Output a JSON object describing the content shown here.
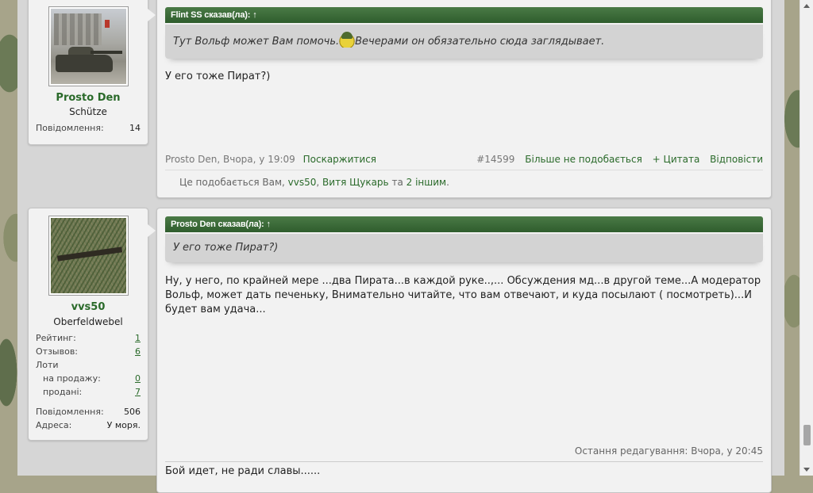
{
  "posts": [
    {
      "author": {
        "name": "Prosto Den",
        "rank": "Schütze",
        "messages_label": "Повідомлення:",
        "messages": "14",
        "avatar": "tank-avatar"
      },
      "quote": {
        "author_line": "Flint SS сказав(ла):",
        "arrow": "↑",
        "text_before": "Тут Вольф может Вам помочь.",
        "text_after": "Вечерами он обязательно сюда заглядывает.",
        "smiley": "soldier-smiley"
      },
      "text": "У его тоже Пират?)",
      "meta": {
        "author_date": "Prosto Den, Вчора, у 19:09",
        "report": "Поскаржитися",
        "post_number": "#14599",
        "unlike": "Більше не подобається",
        "quote": "+ Цитата",
        "reply": "Відповісти"
      },
      "likes": {
        "prefix": "Це подобається Вам,",
        "user1": "vvs50",
        "user2": "Витя Щукарь",
        "middle": "та",
        "others": "2 іншим",
        "suffix": "."
      }
    },
    {
      "author": {
        "name": "vvs50",
        "rank": "Oberfeldwebel",
        "rating_label": "Рейтинг:",
        "rating": "1",
        "reviews_label": "Отзывов:",
        "reviews": "6",
        "lots_label": "Лоти",
        "on_sale_label": "на продажу:",
        "on_sale": "0",
        "sold_label": "продані:",
        "sold": "7",
        "messages_label": "Повідомлення:",
        "messages": "506",
        "address_label": "Адреса:",
        "address": "У моря.",
        "avatar": "camo-rifle-avatar"
      },
      "quote": {
        "author_line": "Prosto Den сказав(ла):",
        "arrow": "↑",
        "text": "У его тоже Пират?)"
      },
      "text": "Ну, у него, по крайней мере ...два Пирата...в каждой руке..,... Обсуждения мд...в другой теме...А модератор Вольф, может дать печеньку, Внимательно читайте, что вам отвечают, и куда посылают ( посмотреть)...И будет вам удача...",
      "edit_note": "Остання редагування: Вчора, у 20:45",
      "signature": "Бой идет, не ради славы......"
    }
  ]
}
